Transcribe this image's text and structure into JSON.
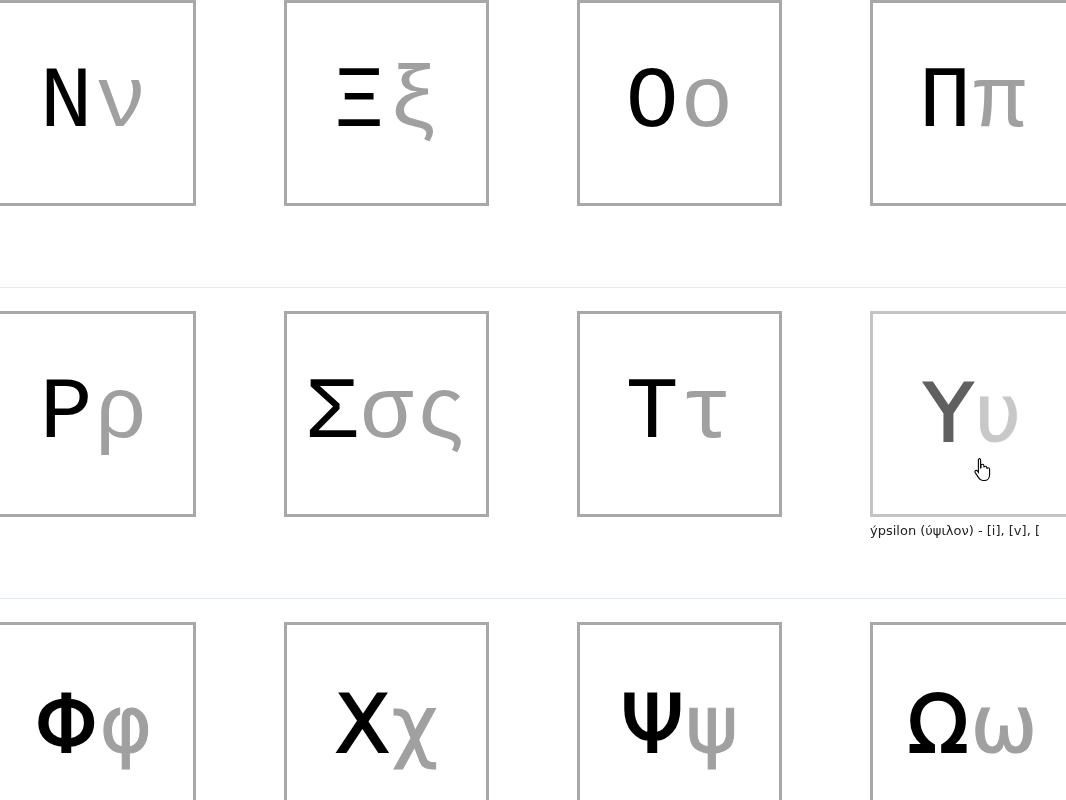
{
  "rows": [
    {
      "cards": [
        {
          "upper": "Ν",
          "lower": [
            "ν"
          ],
          "kind": "mono",
          "hovered": false
        },
        {
          "upper": "Ξ",
          "lower": [
            "ξ"
          ],
          "kind": "mono",
          "hovered": false
        },
        {
          "upper": "Ο",
          "lower": [
            "ο"
          ],
          "kind": "mono",
          "hovered": false
        },
        {
          "upper": "Π",
          "lower": [
            "π"
          ],
          "kind": "mono",
          "hovered": false
        }
      ]
    },
    {
      "cards": [
        {
          "upper": "Ρ",
          "lower": [
            "ρ"
          ],
          "kind": "mono",
          "hovered": false
        },
        {
          "upper": "Σ",
          "lower": [
            "σ",
            "ς"
          ],
          "kind": "mono",
          "hovered": false
        },
        {
          "upper": "Τ",
          "lower": [
            "τ"
          ],
          "kind": "mono",
          "hovered": false
        },
        {
          "upper": "Υ",
          "lower": [
            "υ"
          ],
          "kind": "sans",
          "hovered": true,
          "caption": "ýpsilon (ύψιλον) - [i], [v], ["
        }
      ]
    },
    {
      "cards": [
        {
          "upper": "Φ",
          "lower": [
            "φ"
          ],
          "kind": "sans",
          "hovered": false
        },
        {
          "upper": "Χ",
          "lower": [
            "χ"
          ],
          "kind": "sans",
          "hovered": false
        },
        {
          "upper": "Ψ",
          "lower": [
            "ψ"
          ],
          "kind": "sans",
          "hovered": false
        },
        {
          "upper": "Ω",
          "lower": [
            "ω"
          ],
          "kind": "sans",
          "hovered": false
        }
      ]
    }
  ]
}
